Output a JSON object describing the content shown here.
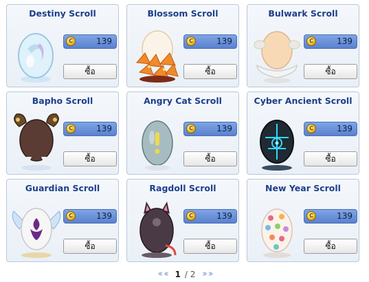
{
  "items": [
    {
      "title": "Destiny Scroll",
      "price": "139",
      "buy": "ซื้อ",
      "art": "destiny-egg-icon"
    },
    {
      "title": "Blossom Scroll",
      "price": "139",
      "buy": "ซื้อ",
      "art": "blossom-egg-icon"
    },
    {
      "title": "Bulwark Scroll",
      "price": "139",
      "buy": "ซื้อ",
      "art": "bulwark-egg-icon"
    },
    {
      "title": "Bapho Scroll",
      "price": "139",
      "buy": "ซื้อ",
      "art": "bapho-egg-icon"
    },
    {
      "title": "Angry Cat Scroll",
      "price": "139",
      "buy": "ซื้อ",
      "art": "angry-cat-egg-icon"
    },
    {
      "title": "Cyber Ancient Scroll",
      "price": "139",
      "buy": "ซื้อ",
      "art": "cyber-ancient-egg-icon"
    },
    {
      "title": "Guardian Scroll",
      "price": "139",
      "buy": "ซื้อ",
      "art": "guardian-egg-icon"
    },
    {
      "title": "Ragdoll Scroll",
      "price": "139",
      "buy": "ซื้อ",
      "art": "ragdoll-egg-icon"
    },
    {
      "title": "New Year Scroll",
      "price": "139",
      "buy": "ซื้อ",
      "art": "new-year-egg-icon"
    }
  ],
  "pagination": {
    "current": "1",
    "separator": "/",
    "total": "2"
  },
  "colors": {
    "title": "#1d3f8a",
    "price_bar": "#6b8fd8",
    "card_border": "#b9c8da"
  }
}
